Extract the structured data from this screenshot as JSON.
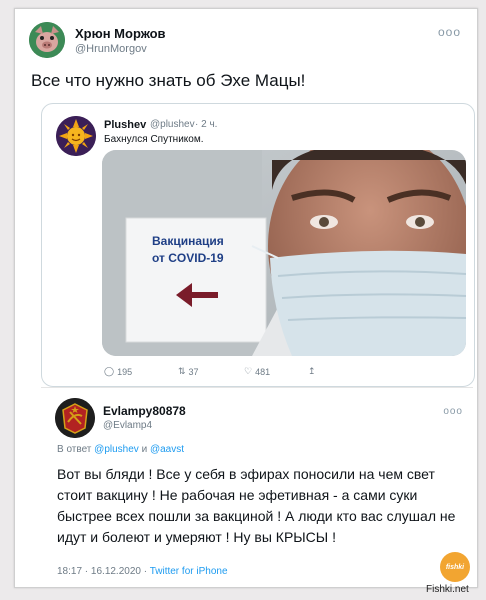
{
  "tweet": {
    "author_name": "Хрюн Моржов",
    "author_handle": "@HrunMorgov",
    "more": "ooo",
    "text": "Все что нужно знать об Эхе Мацы!"
  },
  "quoted": {
    "author_name": "Plushev",
    "author_handle": "@plushev",
    "time": "· 2 ч.",
    "text": "Бахнулся Спутником.",
    "photo_sign": [
      "Вакцинация",
      "от COVID-19"
    ],
    "actions": {
      "replies": "195",
      "retweets": "37",
      "likes": "481"
    }
  },
  "reply": {
    "author_name": "Evlampy80878",
    "author_handle": "@Evlamp4",
    "more": "ooo",
    "reply_prefix": "В ответ",
    "reply_to_1": "@plushev",
    "reply_and": "и",
    "reply_to_2": "@aavst",
    "text": "Вот вы бляди ! Все у себя в эфирах поносили на чем свет стоит вакцину ! Не рабочая не эфетивная - а сами суки быстрее всех пошли за вакциной ! А люди кто вас слушал не идут и болеют и умеряют ! Ну вы КРЫСЫ !",
    "timestamp": "18:17 · 16.12.2020 ·",
    "source": "Twitter for iPhone"
  },
  "watermark": {
    "site": "Fishki.net",
    "logo_text": "fishki"
  },
  "colors": {
    "link": "#1d9bf0",
    "muted": "#6e7b86",
    "arrow": "#7a1c2a",
    "sign_text": "#1f3f86"
  }
}
